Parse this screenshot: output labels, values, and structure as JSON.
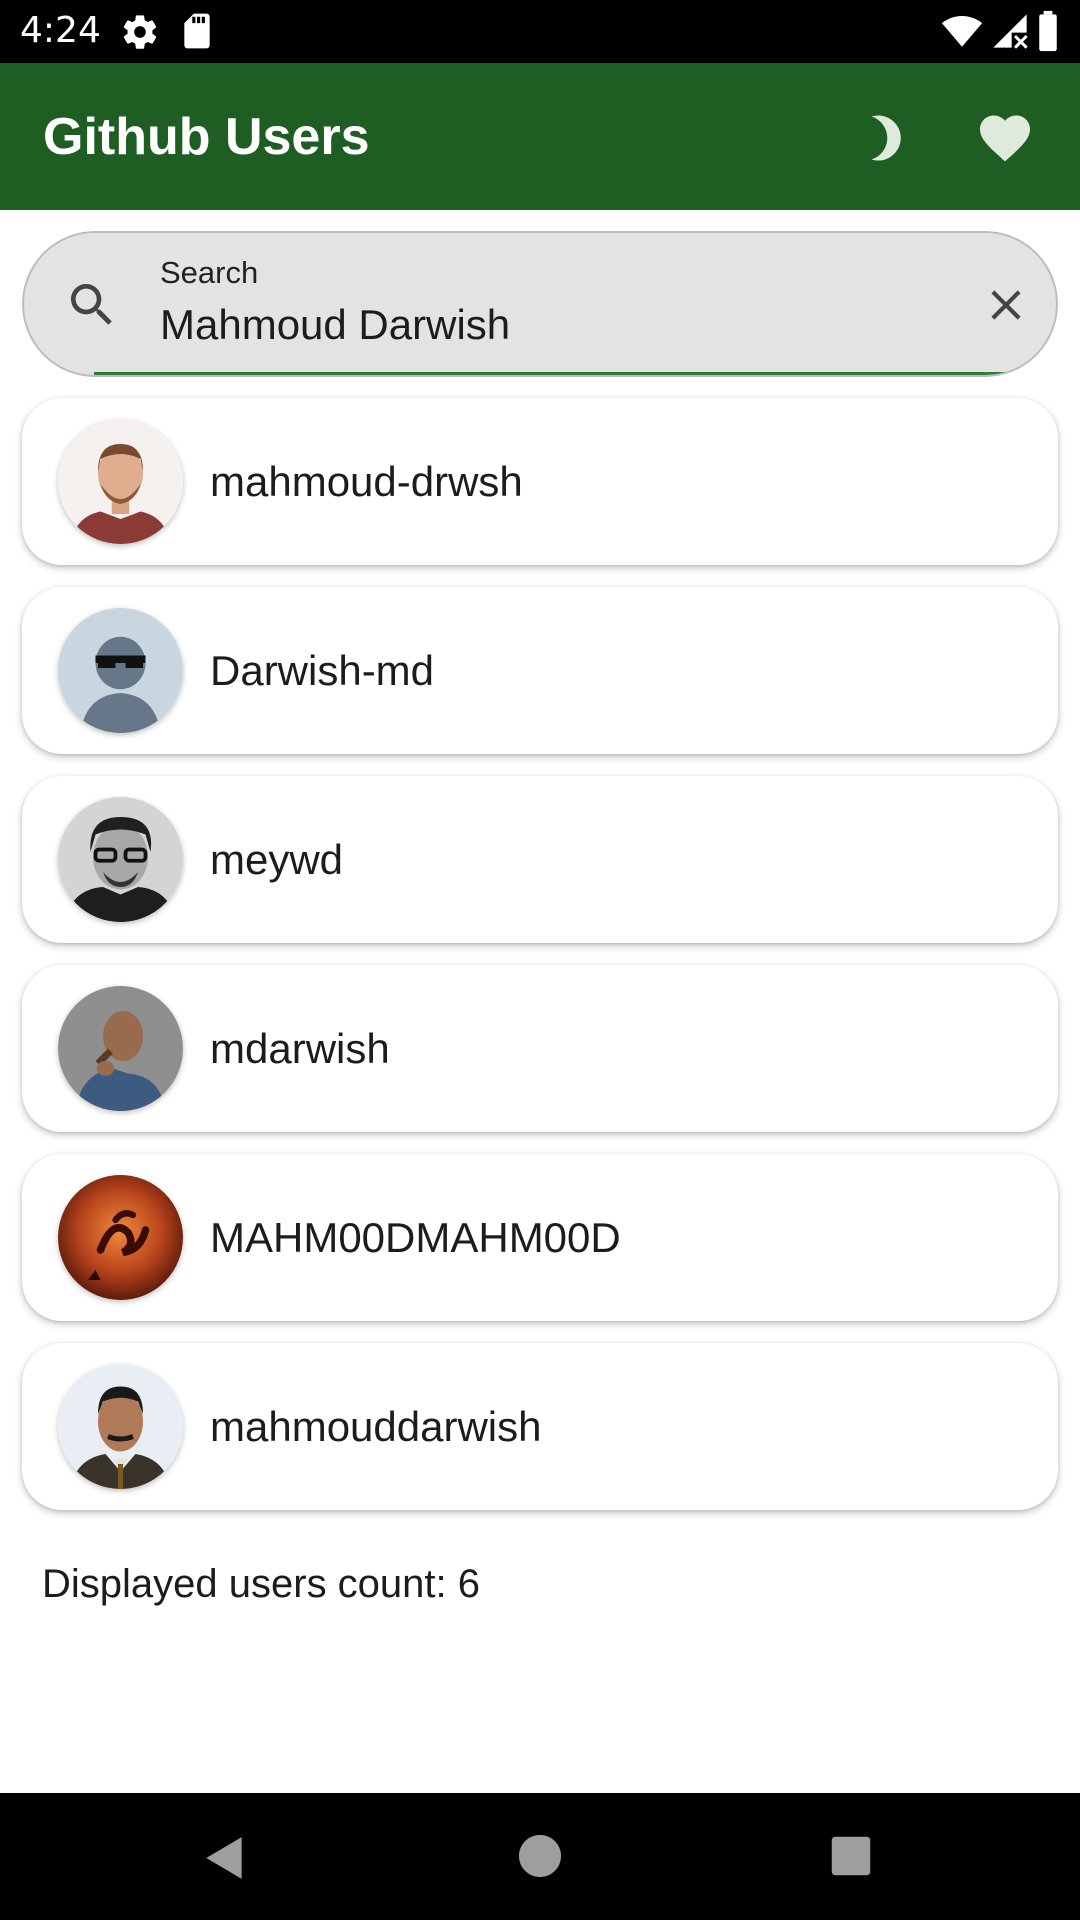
{
  "status_bar": {
    "time": "4:24",
    "icons": [
      "gear-icon",
      "sd-card-icon",
      "wifi-icon",
      "signal-icon",
      "battery-icon"
    ]
  },
  "app_bar": {
    "title": "Github Users",
    "actions": [
      "moon-icon",
      "heart-icon"
    ],
    "background_color": "#1e5e22"
  },
  "search": {
    "label": "Search",
    "value": "Mahmoud Darwish",
    "accent_color": "#2e7d32"
  },
  "users": [
    {
      "login": "mahmoud-drwsh"
    },
    {
      "login": "Darwish-md"
    },
    {
      "login": "meywd"
    },
    {
      "login": "mdarwish"
    },
    {
      "login": "MAHM00DMAHM00D"
    },
    {
      "login": "mahmouddarwish"
    }
  ],
  "footer": {
    "count_text": "Displayed users count: 6"
  },
  "nav_bar": {
    "buttons": [
      "back-icon",
      "home-icon",
      "recents-icon"
    ]
  }
}
